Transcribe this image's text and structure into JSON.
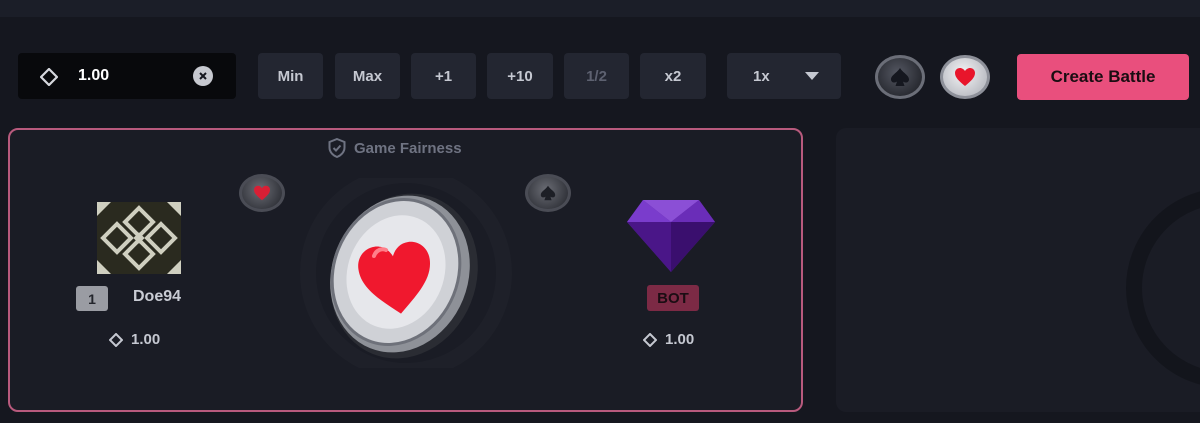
{
  "toolbar": {
    "amount": {
      "value": "1.00",
      "icon": "diamond-icon",
      "clear_icon": "clear-icon"
    },
    "buttons": {
      "min": "Min",
      "max": "Max",
      "plus1": "+1",
      "plus10": "+10",
      "half": "1/2",
      "double": "x2"
    },
    "multiplier": {
      "selected": "1x"
    },
    "side_picks": [
      "spade",
      "heart"
    ],
    "create_label": "Create Battle"
  },
  "battle": {
    "fairness_label": "Game Fairness",
    "player": {
      "level": "1",
      "name": "Doe94",
      "bet": "1.00"
    },
    "opponent": {
      "badge": "BOT",
      "bet": "1.00"
    },
    "coin_side": "heart",
    "player_side": "heart",
    "opponent_side": "spade"
  },
  "colors": {
    "accent": "#e94f7d",
    "panel_border": "#b85a7d",
    "background": "#15171f",
    "bot_badge": "#7c2a45"
  }
}
